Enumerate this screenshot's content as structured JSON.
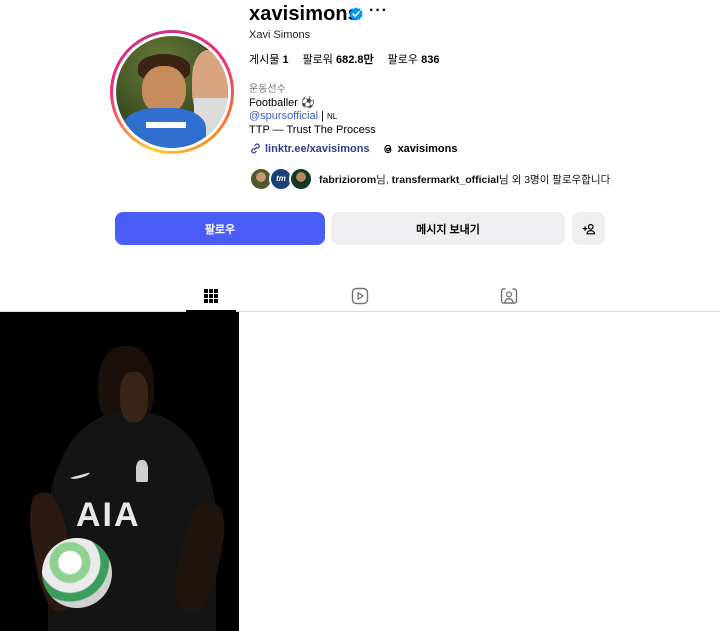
{
  "profile": {
    "username": "xavisimons",
    "more_label": "···",
    "full_name": "Xavi Simons",
    "stats": {
      "posts_label": "게시물",
      "posts_value": "1",
      "followers_label": "팔로워",
      "followers_value": "682.8만",
      "following_label": "팔로우",
      "following_value": "836"
    },
    "category": "운동선수",
    "bio": {
      "line1": "Footballer ⚽",
      "mention": "@spursofficial",
      "separator": " | ",
      "country": "NL",
      "line3": "TTP — Trust The Process"
    },
    "link": "linktr.ee/xavisimons",
    "threads": "xavisimons",
    "followed_by": {
      "mini_logo": "tm",
      "name1": "fabriziorom",
      "suffix1": "님, ",
      "name2": "transfermarkt_official",
      "suffix2": "님 외 3명이 팔로우합니다"
    }
  },
  "actions": {
    "follow_label": "팔로우",
    "message_label": "메시지 보내기",
    "add_icon": "add-person-icon"
  },
  "tabs": {
    "posts_icon": "grid-icon",
    "reels_icon": "reels-icon",
    "tagged_icon": "tagged-icon"
  },
  "post": {
    "sponsor_text": "AIA"
  },
  "colors": {
    "accent": "#4a5df9",
    "verified": "#0095f6",
    "link": "#2c3e8c",
    "mention": "#3a5bdc",
    "muted": "#737373"
  }
}
